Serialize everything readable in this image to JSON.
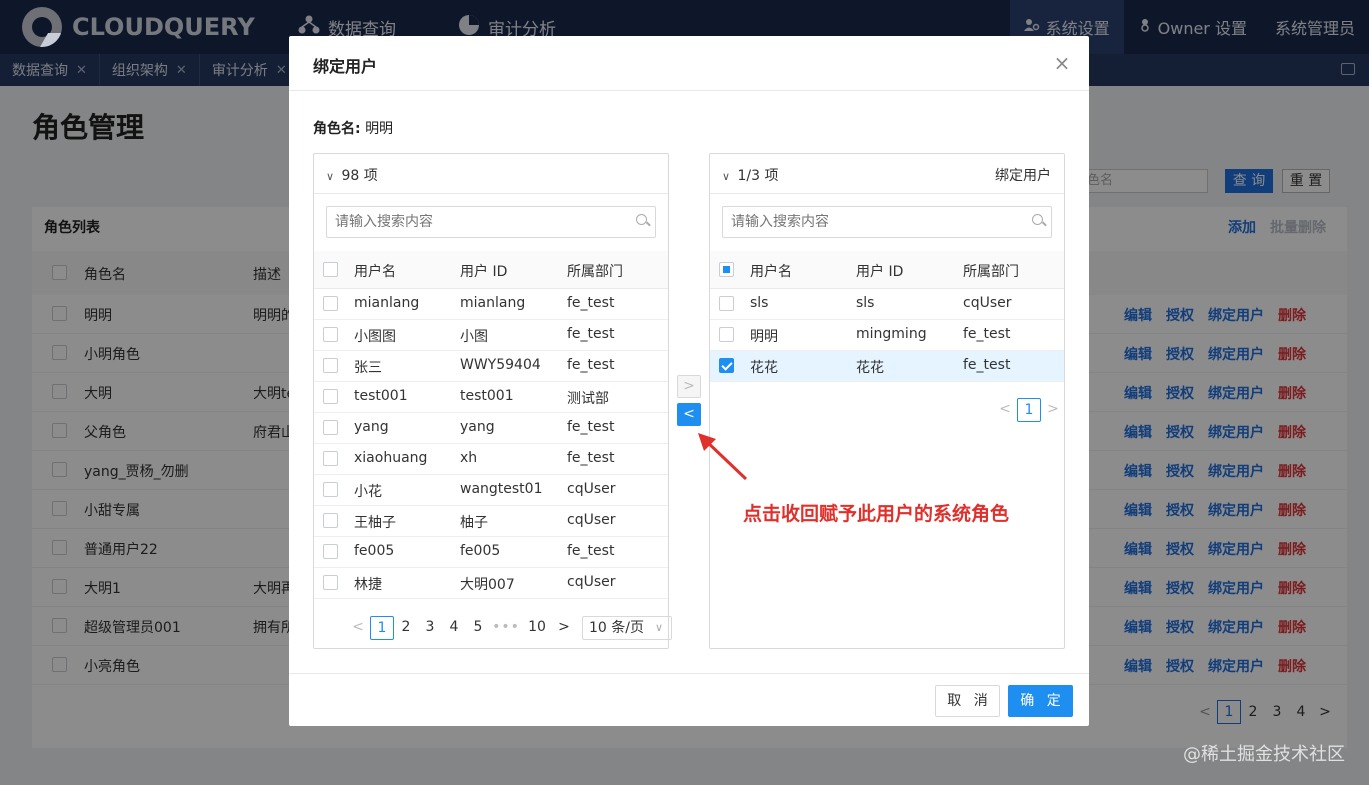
{
  "app": {
    "logo_text": "CLOUDQUERY",
    "nav": [
      {
        "label": "数据查询",
        "icon": "network-icon"
      },
      {
        "label": "审计分析",
        "icon": "pie-chart-icon"
      }
    ],
    "nav_right": [
      {
        "label": "系统设置",
        "icon": "users-gear-icon",
        "active": true
      },
      {
        "label": "Owner 设置",
        "icon": "owner-icon"
      },
      {
        "label": "系统管理员"
      }
    ]
  },
  "tabs": [
    {
      "label": "数据查询"
    },
    {
      "label": "组织架构"
    },
    {
      "label": "审计分析"
    }
  ],
  "background_page": {
    "title": "角色管理",
    "search_placeholder": "色名",
    "query_label": "查 询",
    "reset_label": "重 置",
    "card_title": "角色列表",
    "add_label": "添加",
    "bulk_delete_label": "批量删除",
    "headers": {
      "name": "角色名",
      "desc": "描述"
    },
    "rows": [
      {
        "name": "明明",
        "desc": "明明的"
      },
      {
        "name": "小明角色",
        "desc": ""
      },
      {
        "name": "大明",
        "desc": "大明te"
      },
      {
        "name": "父角色",
        "desc": "府君山"
      },
      {
        "name": "yang_贾杨_勿删",
        "desc": ""
      },
      {
        "name": "小甜专属",
        "desc": ""
      },
      {
        "name": "普通用户22",
        "desc": ""
      },
      {
        "name": "大明1",
        "desc": "大明再"
      },
      {
        "name": "超级管理员001",
        "desc": "拥有所"
      },
      {
        "name": "小亮角色",
        "desc": ""
      }
    ],
    "actions": {
      "edit": "编辑",
      "grant": "授权",
      "bind": "绑定用户",
      "delete": "删除"
    },
    "pager": {
      "prev": "<",
      "pages": [
        "1",
        "2",
        "3",
        "4"
      ],
      "next": ">",
      "current": "1"
    }
  },
  "modal": {
    "title": "绑定用户",
    "close": "×",
    "role_label": "角色名:",
    "role_value": "明明",
    "left": {
      "chevron": "∨",
      "count": "98 项",
      "search_placeholder": "请输入搜索内容",
      "columns": [
        "用户名",
        "用户 ID",
        "所属部门"
      ],
      "rows": [
        [
          "mianlang",
          "mianlang",
          "fe_test"
        ],
        [
          "小图图",
          "小图",
          "fe_test"
        ],
        [
          "张三",
          "WWY59404",
          "fe_test"
        ],
        [
          "test001",
          "test001",
          "测试部"
        ],
        [
          "yang",
          "yang",
          "fe_test"
        ],
        [
          "xiaohuang",
          "xh",
          "fe_test"
        ],
        [
          "小花",
          "wangtest01",
          "cqUser"
        ],
        [
          "王柚子",
          "柚子",
          "cqUser"
        ],
        [
          "fe005",
          "fe005",
          "fe_test"
        ],
        [
          "林捷",
          "大明007",
          "cqUser"
        ]
      ],
      "pager": {
        "prev": "<",
        "pages": [
          "1",
          "2",
          "3",
          "4",
          "5"
        ],
        "ellipsis": "•••",
        "last": "10",
        "next": ">",
        "current": "1",
        "page_size": "10 条/页",
        "dropdown": "∨"
      }
    },
    "right": {
      "chevron": "∨",
      "count": "1/3 项",
      "title": "绑定用户",
      "search_placeholder": "请输入搜索内容",
      "columns": [
        "用户名",
        "用户 ID",
        "所属部门"
      ],
      "rows": [
        {
          "cells": [
            "sls",
            "sls",
            "cqUser"
          ],
          "checked": false
        },
        {
          "cells": [
            "明明",
            "mingming",
            "fe_test"
          ],
          "checked": false
        },
        {
          "cells": [
            "花花",
            "花花",
            "fe_test"
          ],
          "checked": true
        }
      ],
      "pager": {
        "prev": "<",
        "pages": [
          "1"
        ],
        "next": ">",
        "current": "1"
      }
    },
    "move_right": ">",
    "move_left": "<",
    "cancel_label": "取 消",
    "ok_label": "确 定"
  },
  "annotation": "点击收回赋予此用户的系统角色",
  "watermark": "@稀土掘金技术社区",
  "colors": {
    "primary": "#1f8ef1",
    "header_bg": "#1b2a4e",
    "annotation": "#e0302b",
    "danger": "#e0333a"
  }
}
